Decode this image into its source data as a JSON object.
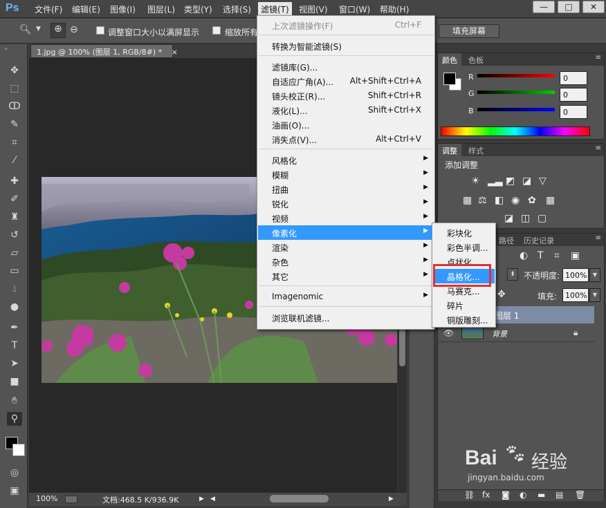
{
  "app": {
    "logo": "Ps"
  },
  "menubar": {
    "items": [
      "文件(F)",
      "编辑(E)",
      "图像(I)",
      "图层(L)",
      "类型(Y)",
      "选择(S)",
      "滤镜(T)",
      "视图(V)",
      "窗口(W)",
      "帮助(H)"
    ],
    "active": "滤镜(T)",
    "window_buttons": [
      "—",
      "□",
      "✕"
    ]
  },
  "options": {
    "resize_window": "调整窗口大小以满屏显示",
    "zoom_all": "缩放所有",
    "fill_screen": "填充屏幕"
  },
  "document": {
    "tab_title": "1.jpg @ 100% (图层 1, RGB/8#) *",
    "tab_close": "×",
    "zoom": "100%",
    "doc_size": "文档:468.5 K/936.9K"
  },
  "filter_menu": {
    "items": [
      {
        "label": "上次滤镜操作(F)",
        "shortcut": "Ctrl+F",
        "disabled": true
      },
      {
        "label": "转换为智能滤镜(S)"
      },
      {
        "label": "滤镜库(G)..."
      },
      {
        "label": "自适应广角(A)...",
        "shortcut": "Alt+Shift+Ctrl+A"
      },
      {
        "label": "镜头校正(R)...",
        "shortcut": "Shift+Ctrl+R"
      },
      {
        "label": "液化(L)...",
        "shortcut": "Shift+Ctrl+X"
      },
      {
        "label": "油画(O)..."
      },
      {
        "label": "消失点(V)...",
        "shortcut": "Alt+Ctrl+V"
      },
      {
        "label": "风格化",
        "submenu": true
      },
      {
        "label": "模糊",
        "submenu": true
      },
      {
        "label": "扭曲",
        "submenu": true
      },
      {
        "label": "锐化",
        "submenu": true
      },
      {
        "label": "视频",
        "submenu": true
      },
      {
        "label": "像素化",
        "submenu": true,
        "highlighted": true
      },
      {
        "label": "渲染",
        "submenu": true
      },
      {
        "label": "杂色",
        "submenu": true
      },
      {
        "label": "其它",
        "submenu": true
      },
      {
        "label": "Imagenomic",
        "submenu": true
      },
      {
        "label": "浏览联机滤镜..."
      }
    ]
  },
  "pixelate_submenu": {
    "items": [
      "彩块化",
      "彩色半调...",
      "点状化...",
      "晶格化...",
      "马赛克...",
      "碎片",
      "铜版雕刻..."
    ],
    "highlighted": "晶格化..."
  },
  "color_panel": {
    "tabs": [
      "颜色",
      "色板"
    ],
    "channels": [
      {
        "label": "R",
        "value": "0"
      },
      {
        "label": "G",
        "value": "0"
      },
      {
        "label": "B",
        "value": "0"
      }
    ]
  },
  "adjust_panel": {
    "tabs": [
      "调整",
      "样式"
    ],
    "title": "添加调整"
  },
  "layers_panel": {
    "tabs_partial": [
      "路径",
      "历史记录"
    ],
    "opacity_label": "不透明度:",
    "opacity_value": "100%",
    "fill_label": "填充:",
    "fill_value": "100%",
    "layers": [
      {
        "name": "图层 1",
        "selected": true
      },
      {
        "name": "背景",
        "locked": true
      }
    ]
  },
  "watermark": {
    "text": "Bai",
    "suffix": "经验",
    "url": "jingyan.baidu.com"
  },
  "colors": {
    "accent": "#3399ff",
    "highlight_box": "#e2312e",
    "menubar": "#454545",
    "panel": "#535353"
  }
}
